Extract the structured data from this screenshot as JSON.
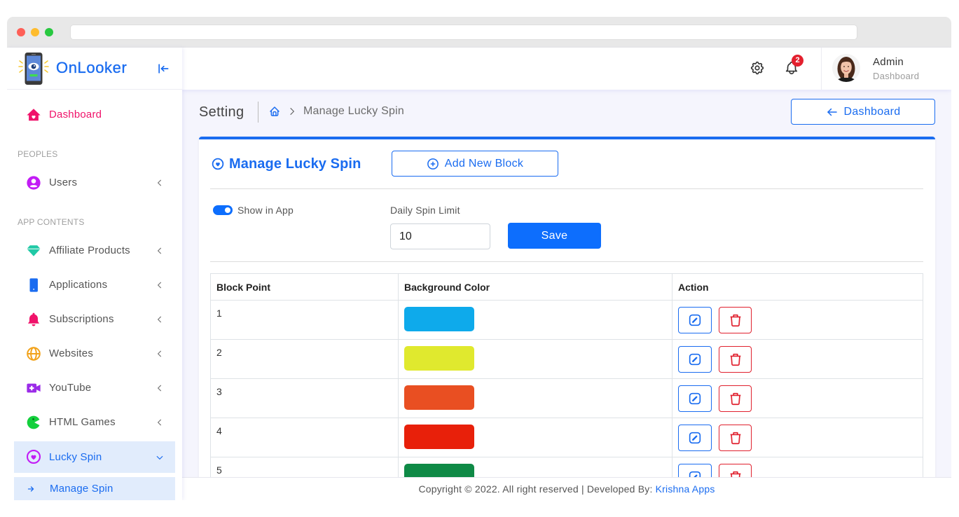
{
  "brand": {
    "name": "OnLooker",
    "color": "#1a6cf0"
  },
  "sidebar": {
    "dashboard": {
      "label": "Dashboard",
      "icon": "home-heart-icon",
      "color": "#f0126a"
    },
    "sections": {
      "peoples": "PEOPLES",
      "app_contents": "APP CONTENTS"
    },
    "items": [
      {
        "label": "Users",
        "icon": "user-circle-icon",
        "color": "#c21cf5"
      },
      {
        "label": "Affiliate Products",
        "icon": "diamond-icon",
        "color": "#20c9a6"
      },
      {
        "label": "Applications",
        "icon": "phone-icon",
        "color": "#1a6cf0"
      },
      {
        "label": "Subscriptions",
        "icon": "bell-icon",
        "color": "#f0126a"
      },
      {
        "label": "Websites",
        "icon": "globe-icon",
        "color": "#f2a21a"
      },
      {
        "label": "YouTube",
        "icon": "video-plus-icon",
        "color": "#9b2be8"
      },
      {
        "label": "HTML Games",
        "icon": "pacman-icon",
        "color": "#13d03c"
      },
      {
        "label": "Lucky Spin",
        "icon": "heart-circle-icon",
        "color": "#c21cf5",
        "active": true,
        "expanded": true,
        "children": [
          {
            "label": "Manage Spin",
            "active": true
          }
        ]
      }
    ]
  },
  "topbar": {
    "notifications_count": "2",
    "user": {
      "name": "Admin",
      "role": "Dashboard"
    }
  },
  "page": {
    "title": "Setting",
    "breadcrumb": {
      "current": "Manage Lucky Spin"
    },
    "back_button": "Dashboard"
  },
  "card": {
    "title": "Manage Lucky Spin",
    "add_button": "Add New Block",
    "show_in_app": {
      "label": "Show in App",
      "checked": true
    },
    "daily_spin_limit": {
      "label": "Daily Spin Limit",
      "value": "10"
    },
    "save_button": "Save",
    "table": {
      "columns": [
        "Block Point",
        "Background Color",
        "Action"
      ],
      "rows": [
        {
          "point": "1",
          "color": "#0eaaeb"
        },
        {
          "point": "2",
          "color": "#e0e92e"
        },
        {
          "point": "3",
          "color": "#e94f22"
        },
        {
          "point": "4",
          "color": "#e8200a"
        },
        {
          "point": "5",
          "color": "#0f8a46"
        }
      ]
    }
  },
  "footer": {
    "text": "Copyright © 2022. All right reserved | Developed By: ",
    "link": "Krishna Apps"
  },
  "theme": {
    "accent": "#1a6cf0",
    "primary_button": "#0d6efd",
    "danger": "#e0202e",
    "background": "#f5f5fd"
  }
}
